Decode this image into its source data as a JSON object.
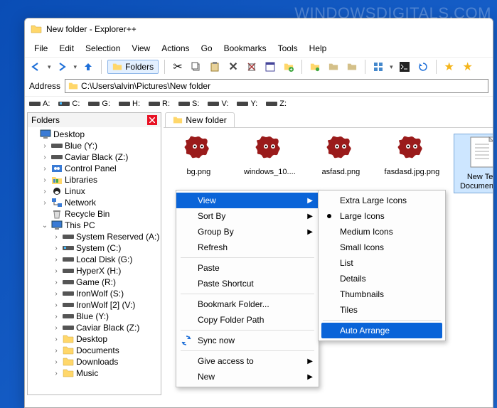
{
  "watermark": "WINDOWSDIGITALS.COM",
  "window": {
    "title": "New folder - Explorer++"
  },
  "menu": [
    "File",
    "Edit",
    "Selection",
    "View",
    "Actions",
    "Go",
    "Bookmarks",
    "Tools",
    "Help"
  ],
  "toolbar": {
    "folders_label": "Folders"
  },
  "address": {
    "label": "Address",
    "path": "C:\\Users\\alvin\\Pictures\\New folder"
  },
  "drives": [
    "A:",
    "C:",
    "G:",
    "H:",
    "R:",
    "S:",
    "V:",
    "Y:",
    "Z:"
  ],
  "folders_pane": {
    "title": "Folders"
  },
  "tree": [
    {
      "indent": 0,
      "exp": "",
      "icon": "desktop",
      "label": "Desktop"
    },
    {
      "indent": 1,
      "exp": "›",
      "icon": "drive",
      "label": "Blue (Y:)"
    },
    {
      "indent": 1,
      "exp": "›",
      "icon": "drive",
      "label": "Caviar Black (Z:)"
    },
    {
      "indent": 1,
      "exp": "›",
      "icon": "ctrl",
      "label": "Control Panel"
    },
    {
      "indent": 1,
      "exp": "›",
      "icon": "libs",
      "label": "Libraries"
    },
    {
      "indent": 1,
      "exp": "›",
      "icon": "linux",
      "label": "Linux"
    },
    {
      "indent": 1,
      "exp": "›",
      "icon": "net",
      "label": "Network"
    },
    {
      "indent": 1,
      "exp": "",
      "icon": "recycle",
      "label": "Recycle Bin"
    },
    {
      "indent": 1,
      "exp": "⌄",
      "icon": "pc",
      "label": "This PC"
    },
    {
      "indent": 2,
      "exp": "›",
      "icon": "drive",
      "label": "System Reserved (A:)"
    },
    {
      "indent": 2,
      "exp": "›",
      "icon": "drive-win",
      "label": "System (C:)"
    },
    {
      "indent": 2,
      "exp": "›",
      "icon": "drive",
      "label": "Local Disk (G:)"
    },
    {
      "indent": 2,
      "exp": "›",
      "icon": "drive",
      "label": "HyperX (H:)"
    },
    {
      "indent": 2,
      "exp": "›",
      "icon": "drive",
      "label": "Game (R:)"
    },
    {
      "indent": 2,
      "exp": "›",
      "icon": "drive",
      "label": "IronWolf (S:)"
    },
    {
      "indent": 2,
      "exp": "›",
      "icon": "drive",
      "label": "IronWolf [2] (V:)"
    },
    {
      "indent": 2,
      "exp": "›",
      "icon": "drive",
      "label": "Blue (Y:)"
    },
    {
      "indent": 2,
      "exp": "›",
      "icon": "drive",
      "label": "Caviar Black (Z:)"
    },
    {
      "indent": 2,
      "exp": "›",
      "icon": "folder",
      "label": "Desktop"
    },
    {
      "indent": 2,
      "exp": "›",
      "icon": "folder",
      "label": "Documents"
    },
    {
      "indent": 2,
      "exp": "›",
      "icon": "folder",
      "label": "Downloads"
    },
    {
      "indent": 2,
      "exp": "›",
      "icon": "folder",
      "label": "Music"
    }
  ],
  "tab": {
    "label": "New folder"
  },
  "files": [
    {
      "icon": "irfan",
      "name": "bg.png"
    },
    {
      "icon": "irfan",
      "name": "windows_10...."
    },
    {
      "icon": "irfan",
      "name": "asfasd.png"
    },
    {
      "icon": "irfan",
      "name": "fasdasd.jpg.png"
    },
    {
      "icon": "txt",
      "name": "New Text Document.txt",
      "selected": true
    }
  ],
  "ctx1": [
    {
      "label": "View",
      "sub": true,
      "hl": true
    },
    {
      "label": "Sort By",
      "sub": true
    },
    {
      "label": "Group By",
      "sub": true
    },
    {
      "label": "Refresh"
    },
    {
      "sep": true
    },
    {
      "label": "Paste"
    },
    {
      "label": "Paste Shortcut"
    },
    {
      "sep": true
    },
    {
      "label": "Bookmark Folder..."
    },
    {
      "label": "Copy Folder Path"
    },
    {
      "sep": true
    },
    {
      "label": "Sync now",
      "icon": "sync"
    },
    {
      "sep": true
    },
    {
      "label": "Give access to",
      "sub": true
    },
    {
      "label": "New",
      "sub": true
    }
  ],
  "ctx2": [
    {
      "label": "Extra Large Icons"
    },
    {
      "label": "Large Icons",
      "radio": true
    },
    {
      "label": "Medium Icons"
    },
    {
      "label": "Small Icons"
    },
    {
      "label": "List"
    },
    {
      "label": "Details"
    },
    {
      "label": "Thumbnails"
    },
    {
      "label": "Tiles"
    },
    {
      "sep": true
    },
    {
      "label": "Auto Arrange",
      "hl": true
    }
  ]
}
